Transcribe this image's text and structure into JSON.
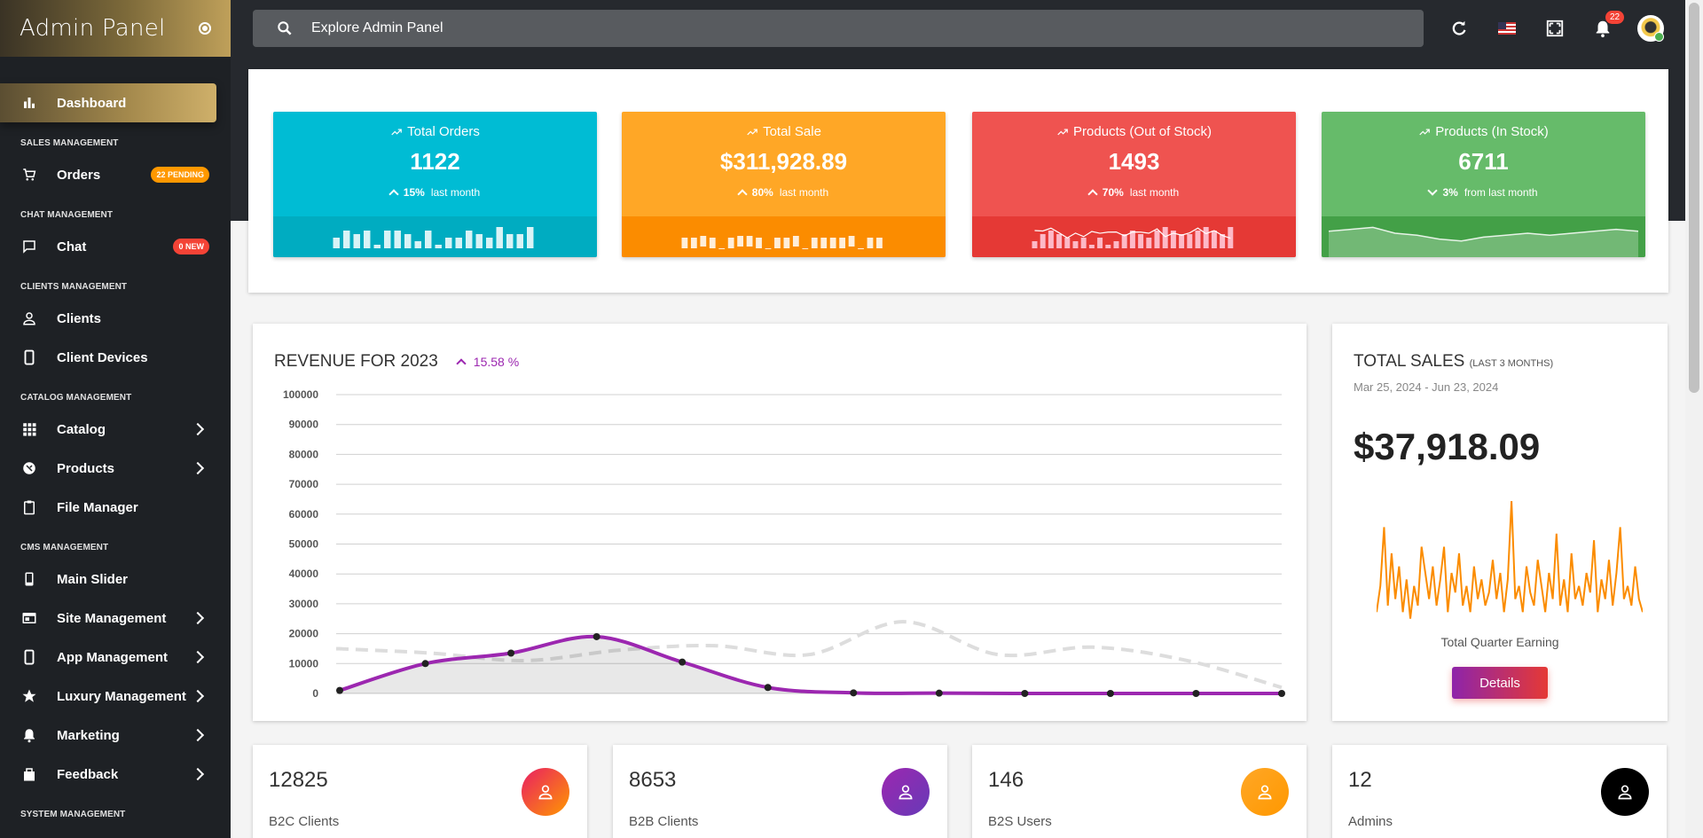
{
  "brand": {
    "title": "Admin Panel"
  },
  "sidebar": {
    "dashboard": "Dashboard",
    "sections": {
      "sales": "SALES MANAGEMENT",
      "chat": "CHAT MANAGEMENT",
      "clients": "CLIENTS MANAGEMENT",
      "catalog": "CATALOG MANAGEMENT",
      "cms": "CMS MANAGEMENT",
      "system": "SYSTEM MANAGEMENT"
    },
    "items": {
      "orders": "Orders",
      "orders_badge": "22 PENDING",
      "chat": "Chat",
      "chat_badge": "0 NEW",
      "clients": "Clients",
      "client_devices": "Client Devices",
      "catalog": "Catalog",
      "products": "Products",
      "file_manager": "File Manager",
      "main_slider": "Main Slider",
      "site_management": "Site Management",
      "app_management": "App Management",
      "luxury_management": "Luxury Management",
      "marketing": "Marketing",
      "feedback": "Feedback"
    }
  },
  "topbar": {
    "search_placeholder": "Explore Admin Panel",
    "notification_count": "22"
  },
  "stats": [
    {
      "title": "Total Orders",
      "value": "1122",
      "sub_pct": "15%",
      "sub_text": "last month",
      "trend": "up",
      "color": "#00bcd4",
      "spark_color": "#00acc1",
      "spark_values": [
        3,
        5,
        4,
        5,
        1,
        5,
        5,
        4,
        2,
        5,
        1,
        3,
        3,
        5,
        4,
        3,
        6,
        4,
        4,
        6
      ]
    },
    {
      "title": "Total Sale",
      "value": "$311,928.89",
      "sub_pct": "80%",
      "sub_text": "last month",
      "trend": "up",
      "color": "#ffa726",
      "spark_color": "#fb8c00",
      "spark_values": [
        3,
        3,
        -3,
        3,
        0,
        3,
        -3,
        -3,
        3,
        0,
        3,
        3,
        -3,
        0,
        3,
        3,
        3,
        3,
        -3,
        0,
        3,
        3
      ]
    },
    {
      "title": "Products (Out of Stock)",
      "value": "1493",
      "sub_pct": "70%",
      "sub_text": "last month",
      "trend": "up",
      "color": "#ef5350",
      "spark_color": "#e53935",
      "spark_values": [
        2,
        4,
        5,
        4,
        3,
        2,
        3,
        1,
        3,
        1,
        2,
        4,
        5,
        4,
        3,
        5,
        6,
        5,
        4,
        4,
        5,
        6,
        5,
        4,
        6
      ]
    },
    {
      "title": "Products (In Stock)",
      "value": "6711",
      "sub_pct": "3%",
      "sub_text": "from last month",
      "trend": "down",
      "color": "#66bb6a",
      "spark_color": "#43a047",
      "spark_values": [
        6,
        7,
        8,
        5,
        4,
        2,
        1,
        3,
        4,
        5,
        4,
        5,
        6,
        7,
        6
      ]
    }
  ],
  "revenue": {
    "title": "REVENUE FOR 2023",
    "pct": "15.58 %"
  },
  "chart_data": {
    "type": "line",
    "title": "REVENUE FOR 2023",
    "y_ticks": [
      100000,
      90000,
      80000,
      70000,
      60000,
      50000,
      40000,
      30000,
      20000,
      10000,
      0
    ],
    "ylim": [
      0,
      100000
    ],
    "grid": true,
    "series": [
      {
        "style": "solid",
        "color": "#9c27b0",
        "values": [
          1000,
          10000,
          13500,
          19000,
          10500,
          2000,
          200,
          100,
          0,
          0,
          0,
          0
        ]
      },
      {
        "style": "dashed",
        "color": "#dddddd",
        "values": [
          15000,
          13500,
          11000,
          14500,
          16000,
          13000,
          24000,
          13000,
          15500,
          11000,
          2000
        ]
      }
    ]
  },
  "total_sales": {
    "title": "TOTAL SALES",
    "title_note": "(LAST 3 MONTHS)",
    "range": "Mar 25, 2024 - Jun 23, 2024",
    "amount": "$37,918.09",
    "caption": "Total Quarter Earning",
    "button": "Details",
    "spark_color": "#fb8c00",
    "spark_values": [
      10,
      30,
      75,
      15,
      55,
      20,
      45,
      10,
      35,
      5,
      30,
      15,
      60,
      40,
      20,
      45,
      15,
      35,
      60,
      10,
      40,
      25,
      55,
      15,
      30,
      10,
      45,
      20,
      35,
      15,
      25,
      50,
      20,
      40,
      10,
      35,
      95,
      20,
      30,
      10,
      45,
      25,
      15,
      50,
      30,
      10,
      40,
      20,
      70,
      15,
      35,
      10,
      55,
      20,
      30,
      15,
      40,
      25,
      65,
      10,
      35,
      20,
      50,
      15,
      40,
      75,
      20,
      30,
      15,
      45,
      20,
      10
    ]
  },
  "mini_cards": [
    {
      "value": "12825",
      "label": "B2C Clients",
      "color": "linear-gradient(135deg,#e91e63,#ff9800)"
    },
    {
      "value": "8653",
      "label": "B2B Clients",
      "color": "linear-gradient(135deg,#9c27b0,#673ab7)"
    },
    {
      "value": "146",
      "label": "B2S Users",
      "color": "linear-gradient(135deg,#ffa726,#ff9800)"
    },
    {
      "value": "12",
      "label": "Admins",
      "color": "#000000"
    }
  ]
}
